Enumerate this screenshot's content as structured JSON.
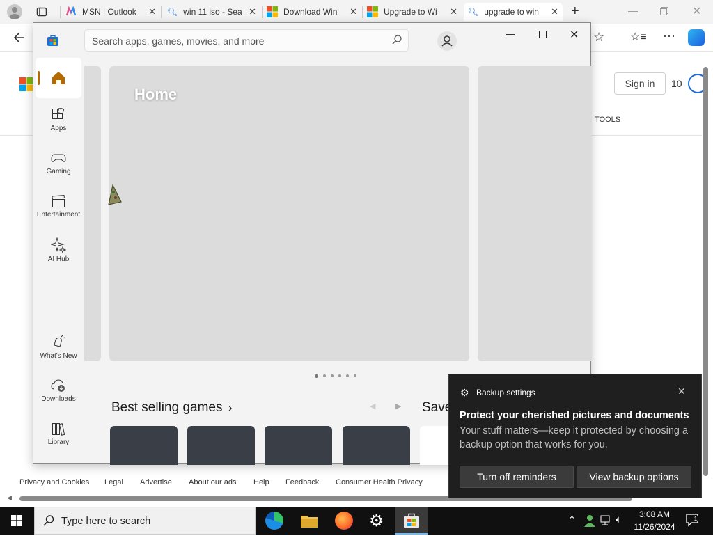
{
  "browser": {
    "tabs": [
      {
        "label": "MSN | Outlook",
        "icon": "msn-icon"
      },
      {
        "label": "win 11 iso - Sea",
        "icon": "search-icon"
      },
      {
        "label": "Download Win",
        "icon": "windows-logo-icon"
      },
      {
        "label": "Upgrade to Wi",
        "icon": "windows-logo-icon"
      },
      {
        "label": "upgrade to win",
        "icon": "search-icon"
      }
    ]
  },
  "msn": {
    "sign_in": "Sign in",
    "points": "10",
    "tools": "TOOLS",
    "footer": [
      "Privacy and Cookies",
      "Legal",
      "Advertise",
      "About our ads",
      "Help",
      "Feedback",
      "Consumer Health Privacy"
    ]
  },
  "store": {
    "search_placeholder": "Search apps, games, movies, and more",
    "nav": [
      {
        "label": "Apps"
      },
      {
        "label": "Gaming"
      },
      {
        "label": "Entertainment"
      },
      {
        "label": "AI Hub"
      },
      {
        "label": "What's New"
      },
      {
        "label": "Downloads"
      },
      {
        "label": "Library"
      }
    ],
    "hero_title": "Home",
    "section_title": "Best selling games",
    "next_section": "Save"
  },
  "toast": {
    "app": "Backup settings",
    "title": "Protect your cherished pictures and documents",
    "body": "Your stuff matters—keep it protected by choosing a backup option that works for you.",
    "button1": "Turn off reminders",
    "button2": "View backup options"
  },
  "taskbar": {
    "search_placeholder": "Type here to search",
    "time": "3:08 AM",
    "date": "11/26/2024"
  },
  "colors": {
    "accent_home": "#b36b00",
    "taskbar": "#101010",
    "toast_bg": "#1f1f1f"
  }
}
